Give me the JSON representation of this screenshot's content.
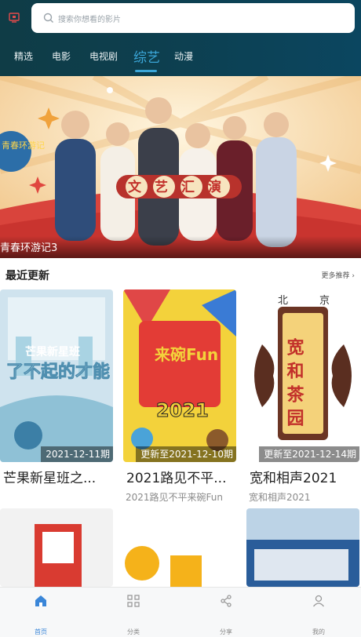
{
  "header": {
    "search_placeholder": "搜索你想看的影片",
    "tabs": [
      {
        "label": "精选"
      },
      {
        "label": "电影"
      },
      {
        "label": "电视剧"
      },
      {
        "label": "综艺"
      },
      {
        "label": "动漫"
      }
    ],
    "active_tab": "综艺"
  },
  "banner": {
    "caption": "青春环游记3",
    "logo_text": "文艺汇演",
    "side_logo": "青春环游记"
  },
  "recent": {
    "title": "最近更新",
    "more": "更多推荐"
  },
  "cards": [
    {
      "title": "芒果新星班之...",
      "subtitle": "",
      "badge": "2021-12-11期",
      "poster_text": "了不起的才能",
      "poster_brand": "芒果新星班"
    },
    {
      "title": "2021路见不平...",
      "subtitle": "2021路见不平来碗Fun",
      "badge": "更新至2021-12-10期",
      "poster_text": "来碗Fun",
      "poster_year": "2021"
    },
    {
      "title": "宽和相声2021",
      "subtitle": "宽和相声2021",
      "badge": "更新至2021-12-14期",
      "poster_text": "宽和茶园",
      "poster_top": "北京"
    }
  ],
  "bottom_nav": [
    {
      "label": "首页",
      "icon": "home-icon"
    },
    {
      "label": "分类",
      "icon": "grid-icon"
    },
    {
      "label": "分享",
      "icon": "share-icon"
    },
    {
      "label": "我的",
      "icon": "user-icon"
    }
  ],
  "colors": {
    "accent": "#3ba6d8",
    "header_bg": "#0f3c46",
    "nav_active": "#3a86d8"
  }
}
